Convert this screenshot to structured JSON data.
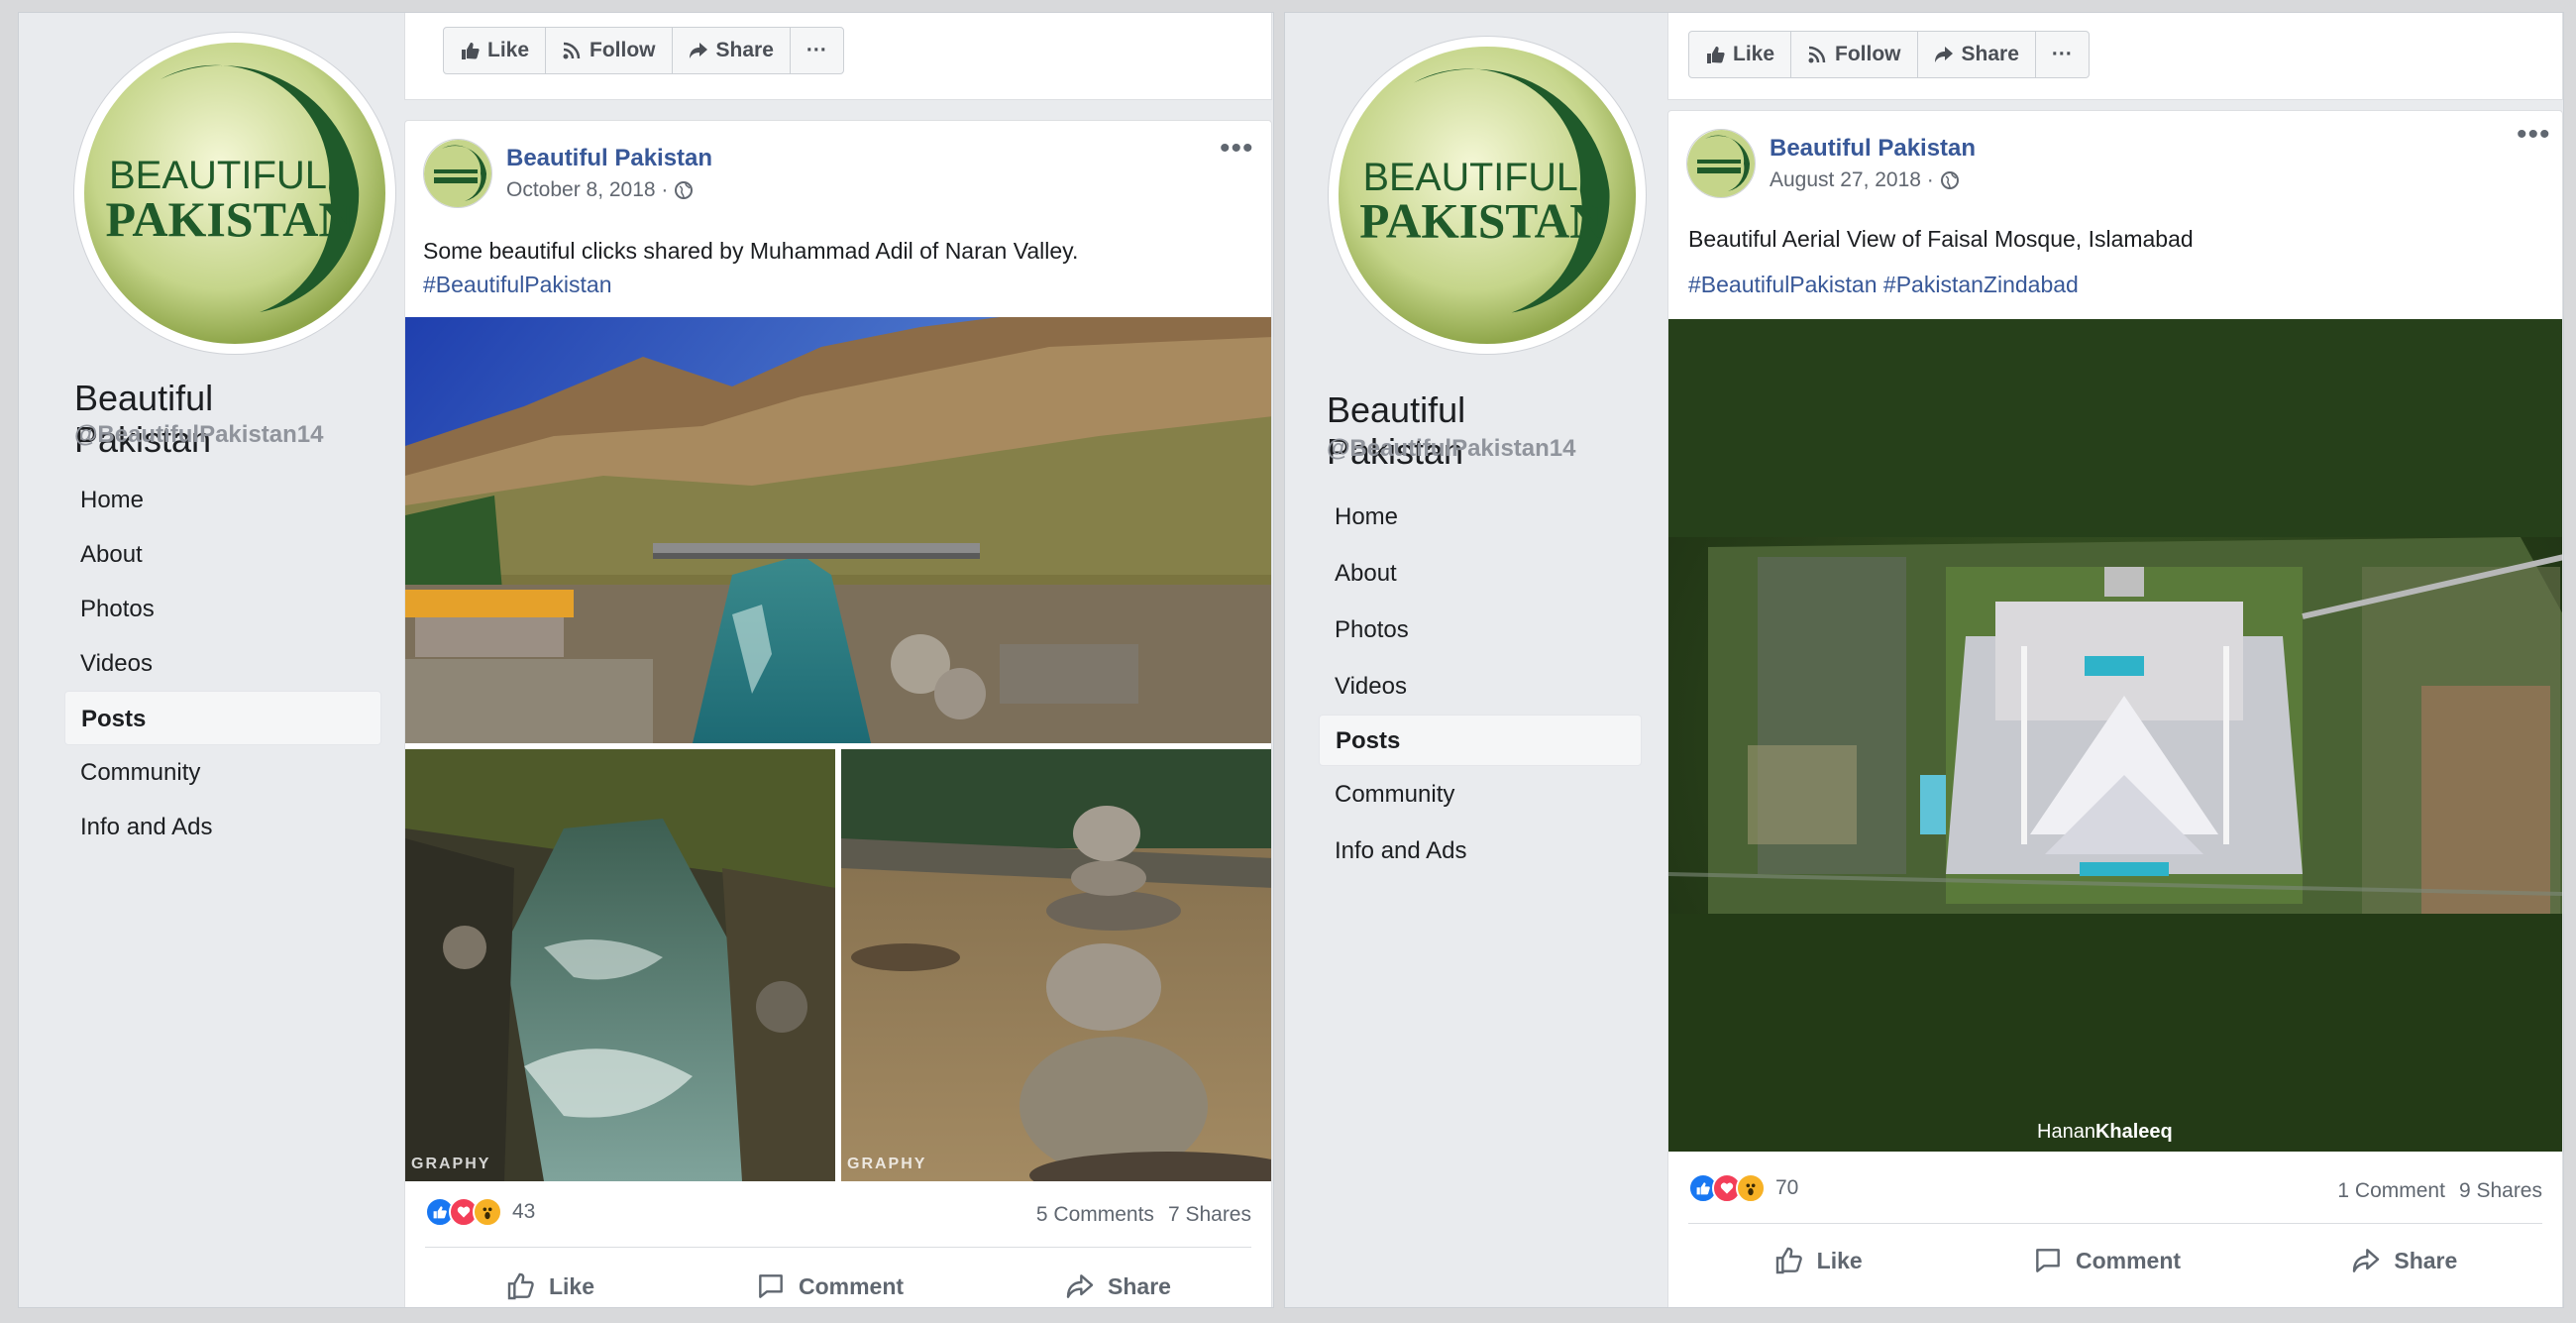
{
  "panels": [
    {
      "page": {
        "name": "Beautiful Pakistan",
        "handle": "@BeautifulPakistan14",
        "logo_line1": "BEAUTIFUL",
        "logo_line2": "PAKISTAN"
      },
      "nav": [
        "Home",
        "About",
        "Photos",
        "Videos",
        "Posts",
        "Community",
        "Info and Ads"
      ],
      "active_nav": "Posts",
      "toolbar": {
        "like": "Like",
        "follow": "Follow",
        "share": "Share",
        "more": "···"
      },
      "post": {
        "author": "Beautiful Pakistan",
        "date": "October 8, 2018 ·",
        "text": "Some beautiful clicks shared by Muhammad Adil of Naran Valley.",
        "hashtags": "#BeautifulPakistan",
        "photo_watermark_1": "GRAPHY",
        "photo_watermark_2": "GRAPHY",
        "reaction_count": "43",
        "comments": "5 Comments",
        "shares": "7 Shares",
        "actions": {
          "like": "Like",
          "comment": "Comment",
          "share": "Share"
        }
      }
    },
    {
      "page": {
        "name": "Beautiful Pakistan",
        "handle": "@BeautifulPakistan14",
        "logo_line1": "BEAUTIFUL",
        "logo_line2": "PAKISTAN"
      },
      "nav": [
        "Home",
        "About",
        "Photos",
        "Videos",
        "Posts",
        "Community",
        "Info and Ads"
      ],
      "active_nav": "Posts",
      "toolbar": {
        "like": "Like",
        "follow": "Follow",
        "share": "Share",
        "more": "···"
      },
      "post": {
        "author": "Beautiful Pakistan",
        "date": "August 27, 2018 ·",
        "text": "Beautiful Aerial View of Faisal Mosque, Islamabad",
        "hashtags": "#BeautifulPakistan #PakistanZindabad",
        "photo_credit_first": "Hanan",
        "photo_credit_last": "Khaleeq",
        "reaction_count": "70",
        "comments": "1 Comment",
        "shares": "9 Shares",
        "actions": {
          "like": "Like",
          "comment": "Comment",
          "share": "Share"
        }
      }
    }
  ],
  "colors": {
    "link": "#385898",
    "like_blue": "#1877f2",
    "love_red": "#f33e58",
    "wow_yellow": "#f7b125",
    "logo_green": "#1f5a2a",
    "logo_bg": "#c9d98f"
  }
}
